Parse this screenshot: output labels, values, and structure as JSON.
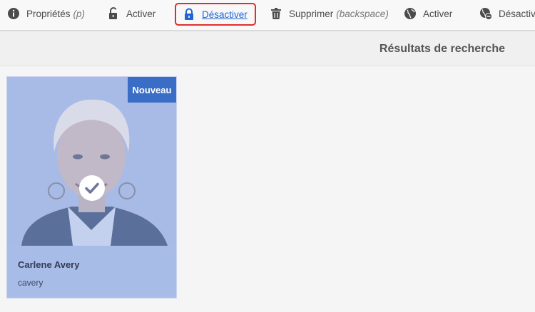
{
  "toolbar": {
    "items": [
      {
        "label": "Propriétés",
        "hint": "(p)",
        "icon": "info-icon"
      },
      {
        "label": "Activer",
        "icon": "unlock-icon"
      },
      {
        "label": "Désactiver",
        "icon": "lock-icon"
      },
      {
        "label": "Supprimer",
        "hint": "(backspace)",
        "icon": "trash-icon"
      },
      {
        "label": "Activer",
        "icon": "globe-icon"
      },
      {
        "label": "Désactiver",
        "icon": "globe-minus-icon"
      }
    ]
  },
  "header": {
    "title": "Résultats de recherche"
  },
  "results": [
    {
      "badge": "Nouveau",
      "name": "Carlene Avery",
      "username": "cavery",
      "selected": true,
      "icon": "checkmark-icon"
    }
  ],
  "colors": {
    "highlight_border": "#e32b2b",
    "link": "#2065d6",
    "badge": "#3a6dc6",
    "card_overlay": "#a8bce8"
  }
}
